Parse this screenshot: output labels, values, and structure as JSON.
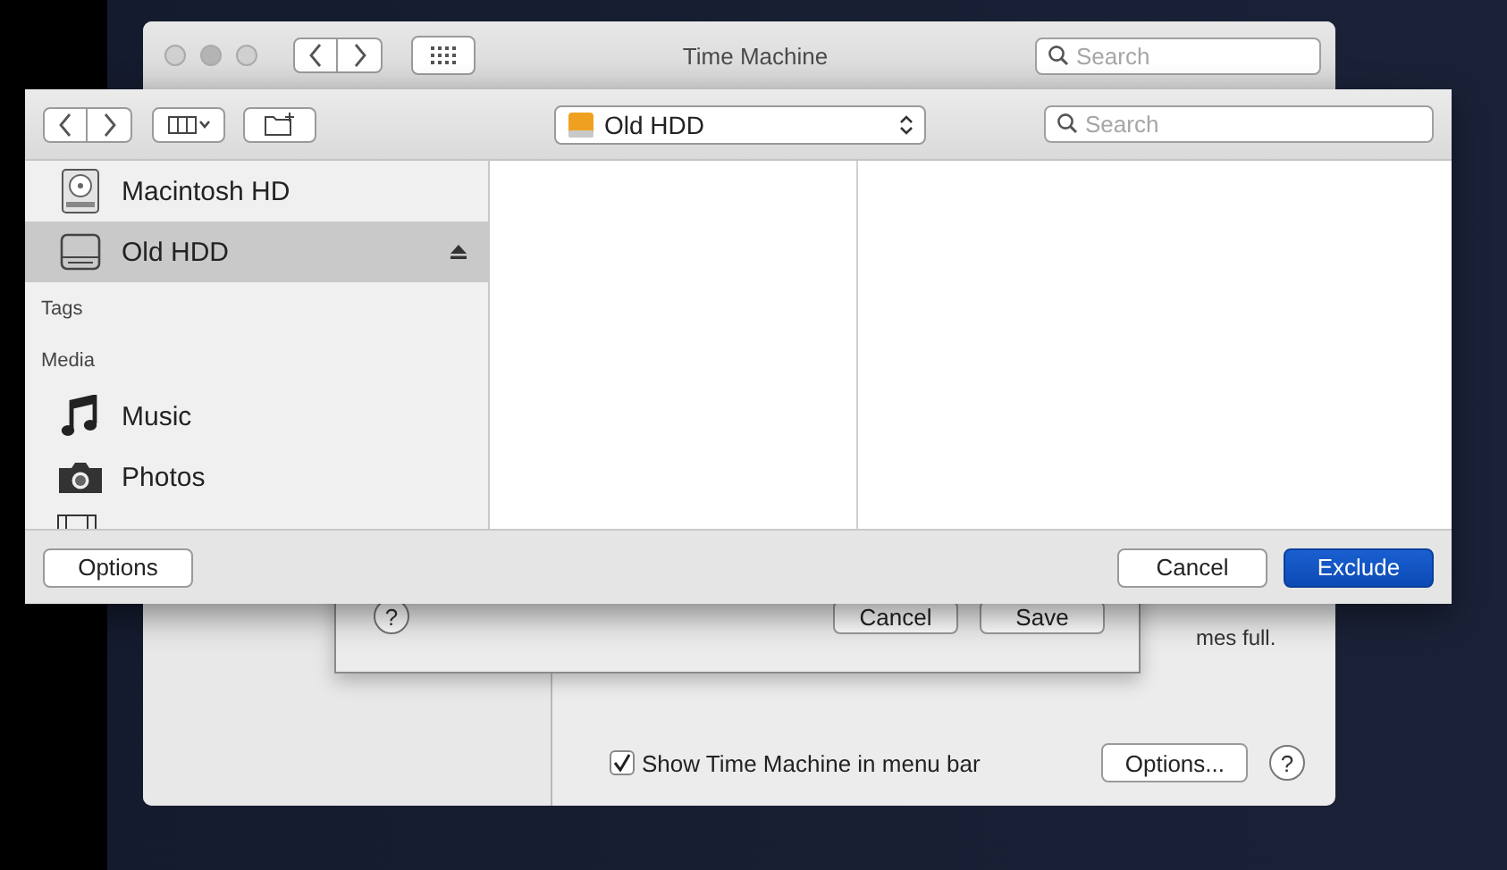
{
  "back_window": {
    "title": "Time Machine",
    "search": {
      "placeholder": "Search"
    },
    "partial_text": "mes full.",
    "show_in_menu_bar": {
      "label": "Show Time Machine in menu bar",
      "checked": true
    },
    "options_button": "Options...",
    "help_button": "?"
  },
  "sheet": {
    "help_button": "?",
    "cancel_button": "Cancel",
    "save_button": "Save"
  },
  "dialog": {
    "location": "Old HDD",
    "search": {
      "placeholder": "Search"
    },
    "sidebar": {
      "devices": [
        {
          "label": "Macintosh HD",
          "kind": "internal-disk",
          "selected": false,
          "ejectable": false
        },
        {
          "label": "Old HDD",
          "kind": "external-disk",
          "selected": true,
          "ejectable": true
        }
      ],
      "tags_heading": "Tags",
      "media_heading": "Media",
      "media": [
        {
          "label": "Music",
          "kind": "music",
          "selected": false
        },
        {
          "label": "Photos",
          "kind": "photos",
          "selected": false
        }
      ]
    },
    "options_button": "Options",
    "cancel_button": "Cancel",
    "exclude_button": "Exclude"
  }
}
